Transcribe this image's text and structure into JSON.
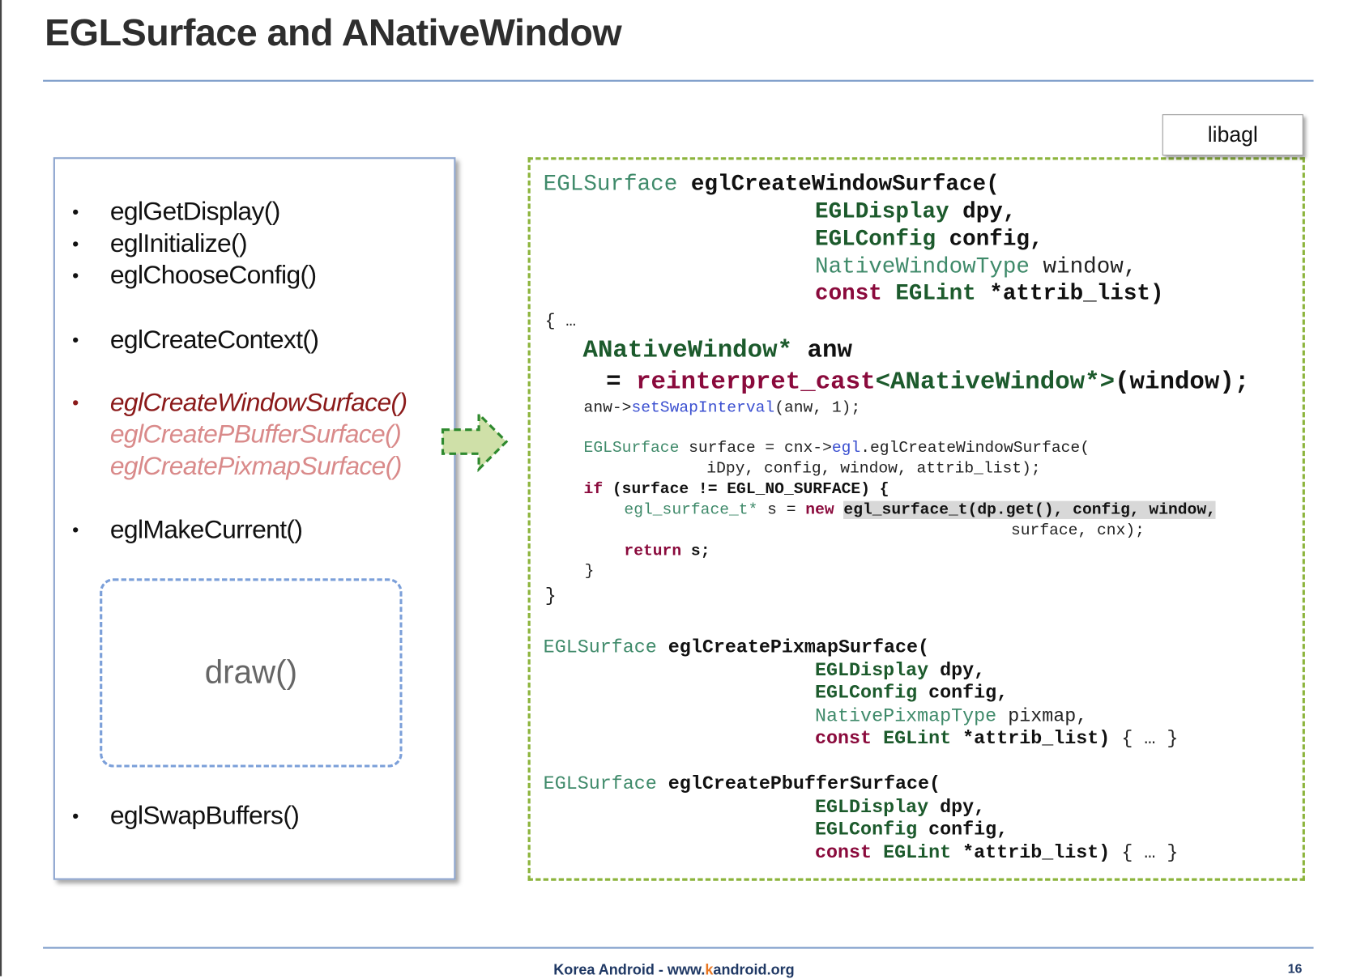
{
  "title": "EGLSurface and ANativeWindow",
  "lib_label": "libagl",
  "api_list": [
    {
      "text": "eglGetDisplay()",
      "bullet": "•",
      "style": "normal"
    },
    {
      "text": "eglInitialize()",
      "bullet": "•",
      "style": "normal"
    },
    {
      "text": "eglChooseConfig()",
      "bullet": "•",
      "style": "normal"
    },
    {
      "text": "eglCreateContext()",
      "bullet": "•",
      "style": "normal"
    },
    {
      "text": "eglCreateWindowSurface()",
      "bullet": "•",
      "style": "highlight"
    },
    {
      "text": "eglCreatePBufferSurface()",
      "bullet": "",
      "style": "faded"
    },
    {
      "text": "eglCreatePixmapSurface()",
      "bullet": "",
      "style": "faded"
    },
    {
      "text": "eglMakeCurrent()",
      "bullet": "•",
      "style": "normal"
    },
    {
      "text": "eglSwapBuffers()",
      "bullet": "•",
      "style": "normal"
    }
  ],
  "draw_label": "draw()",
  "code": [
    [
      [
        "ty",
        "EGLSurface "
      ],
      [
        "bd",
        "eglCreateWindowSurface("
      ]
    ],
    [
      [
        "tb",
        "EGLDisplay "
      ],
      [
        "bd",
        "dpy,"
      ]
    ],
    [
      [
        "tb",
        "EGLConfig "
      ],
      [
        "bd",
        "config,"
      ]
    ],
    [
      [
        "ty",
        "NativeWindowType "
      ],
      [
        "pl",
        "window,"
      ]
    ],
    [
      [
        "kw",
        "const "
      ],
      [
        "tb",
        "EGLint "
      ],
      [
        "bd",
        "*attrib_list)"
      ]
    ],
    [
      [
        "pl",
        "{ …"
      ]
    ],
    [
      [
        "tb",
        "ANativeWindow* "
      ],
      [
        "bd",
        "anw"
      ]
    ],
    [
      [
        "bd",
        "= "
      ],
      [
        "kw",
        "reinterpret_cast"
      ],
      [
        "tb",
        "<ANativeWindow*>"
      ],
      [
        "bd",
        "(window);"
      ]
    ],
    [
      [
        "pl",
        "anw->"
      ],
      [
        "fn",
        "setSwapInterval"
      ],
      [
        "pl",
        "(anw, 1);"
      ]
    ],
    [
      [
        "ty",
        "EGLSurface "
      ],
      [
        "pl",
        "surface = cnx->"
      ],
      [
        "fn",
        "egl"
      ],
      [
        "pl",
        ".eglCreateWindowSurface("
      ]
    ],
    [
      [
        "pl",
        "iDpy, config, window, attrib_list);"
      ]
    ],
    [
      [
        "kw",
        "if "
      ],
      [
        "bd",
        "(surface != EGL_NO_SURFACE) {"
      ]
    ],
    [
      [
        "ty",
        "egl_surface_t* "
      ],
      [
        "pl",
        "s = "
      ],
      [
        "kw",
        "new "
      ],
      [
        "hlbd",
        "egl_surface_t(dp.get(), config, window,"
      ]
    ],
    [
      [
        "pl",
        "surface, cnx);"
      ]
    ],
    [
      [
        "kw",
        "return "
      ],
      [
        "bd",
        "s;"
      ]
    ],
    [
      [
        "pl",
        "}"
      ]
    ],
    [
      [
        "pl",
        "}"
      ]
    ],
    [
      [
        "ty",
        "EGLSurface "
      ],
      [
        "bd",
        "eglCreatePixmapSurface("
      ]
    ],
    [
      [
        "tb",
        "EGLDisplay "
      ],
      [
        "bd",
        "dpy,"
      ]
    ],
    [
      [
        "tb",
        "EGLConfig "
      ],
      [
        "bd",
        "config,"
      ]
    ],
    [
      [
        "ty",
        "NativePixmapType "
      ],
      [
        "pl",
        "pixmap,"
      ]
    ],
    [
      [
        "kw",
        "const "
      ],
      [
        "tb",
        "EGLint "
      ],
      [
        "bd",
        "*attrib_list) "
      ],
      [
        "pl",
        "{ … }"
      ]
    ],
    [
      [
        "ty",
        "EGLSurface "
      ],
      [
        "bd",
        "eglCreatePbufferSurface("
      ]
    ],
    [
      [
        "tb",
        "EGLDisplay "
      ],
      [
        "bd",
        "dpy,"
      ]
    ],
    [
      [
        "tb",
        "EGLConfig "
      ],
      [
        "bd",
        "config,"
      ]
    ],
    [
      [
        "kw",
        "const "
      ],
      [
        "tb",
        "EGLint "
      ],
      [
        "bd",
        "*attrib_list) "
      ],
      [
        "pl",
        "{ … }"
      ]
    ]
  ],
  "footer": {
    "prefix": "Korea Android - www.",
    "accent": "k",
    "suffix": "android.org",
    "page": "16"
  },
  "colors": {
    "rule": "#7b9bc9",
    "code_border": "#8cb43c",
    "highlight_api": "#8b1a1a",
    "faded_api": "#d98a8a",
    "footer_accent": "#e87722"
  }
}
